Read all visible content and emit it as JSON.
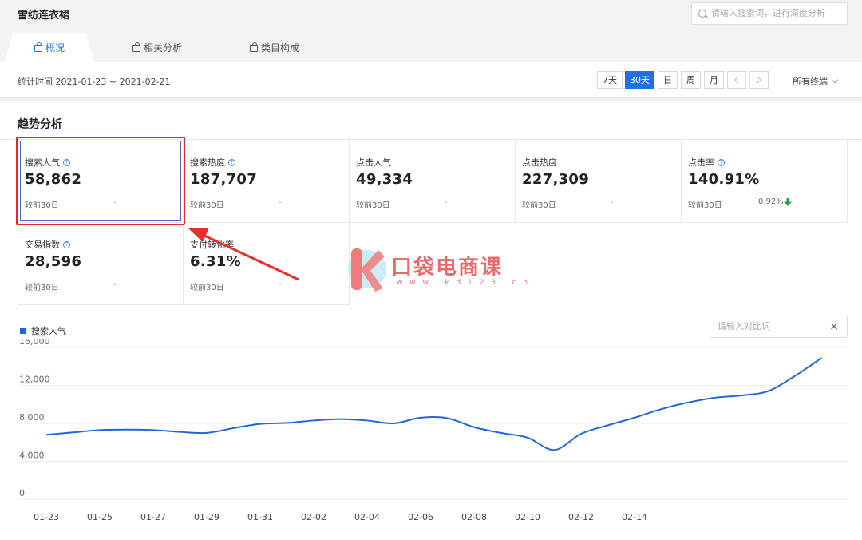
{
  "header": {
    "title": "雪纺连衣裙",
    "search_placeholder": "请输入搜索词，进行深度分析",
    "tabs": [
      {
        "label": "概况",
        "active": true
      },
      {
        "label": "相关分析",
        "active": false
      },
      {
        "label": "类目构成",
        "active": false
      }
    ]
  },
  "stat_bar": {
    "time_label": "统计时间 2021-01-23 ~ 2021-02-21",
    "ranges": [
      "7天",
      "30天",
      "日",
      "周",
      "月"
    ],
    "active_range": "30天",
    "terminal": "所有终端"
  },
  "trend": {
    "title": "趋势分析",
    "metrics": [
      {
        "label": "搜索人气",
        "help": true,
        "value": "58,862",
        "compare": "较前30日",
        "change": "-"
      },
      {
        "label": "搜索热度",
        "help": true,
        "value": "187,707",
        "compare": "较前30日",
        "change": "-"
      },
      {
        "label": "点击人气",
        "help": false,
        "value": "49,334",
        "compare": "较前30日",
        "change": "-"
      },
      {
        "label": "点击热度",
        "help": false,
        "value": "227,309",
        "compare": "较前30日",
        "change": "-"
      },
      {
        "label": "点击率",
        "help": true,
        "value": "140.91%",
        "compare": "较前30日",
        "change": "0.92%",
        "direction": "down"
      },
      {
        "label": "交易指数",
        "help": true,
        "value": "28,596",
        "compare": "较前30日",
        "change": "-"
      },
      {
        "label": "支付转化率",
        "help": false,
        "value": "6.31%",
        "compare": "较前30日",
        "change": "-"
      }
    ]
  },
  "watermark": {
    "brand": "口袋电商课",
    "url": "w w w . k d 1 2 3 . c n"
  },
  "chart": {
    "legend": "搜索人气",
    "compare_placeholder": "请输入对比词",
    "close_glyph": "×"
  },
  "chart_data": {
    "type": "line",
    "ylim": [
      0,
      16000
    ],
    "yticks": [
      "0",
      "4,000",
      "8,000",
      "12,000",
      "16,000"
    ],
    "xticks": [
      "01-23",
      "01-25",
      "01-27",
      "01-29",
      "01-31",
      "02-02",
      "02-04",
      "02-06",
      "02-08",
      "02-10",
      "02-12",
      "02-14"
    ],
    "x": [
      "01-23",
      "01-24",
      "01-25",
      "01-26",
      "01-27",
      "01-28",
      "01-29",
      "01-30",
      "01-31",
      "02-01",
      "02-02",
      "02-03",
      "02-04",
      "02-05",
      "02-06",
      "02-07",
      "02-08",
      "02-09",
      "02-10",
      "02-11",
      "02-12",
      "02-13",
      "02-14",
      "02-15",
      "02-16",
      "02-17",
      "02-18",
      "02-19",
      "02-20",
      "02-21"
    ],
    "series": [
      {
        "name": "搜索人气",
        "color": "#2366d9",
        "values": [
          6800,
          7050,
          7300,
          7350,
          7300,
          7100,
          7000,
          7500,
          7950,
          8050,
          8300,
          8450,
          8300,
          8000,
          8600,
          8550,
          7600,
          7000,
          6500,
          5200,
          6900,
          7800,
          8600,
          9500,
          10200,
          10700,
          10950,
          11400,
          13000,
          14900
        ]
      }
    ]
  }
}
